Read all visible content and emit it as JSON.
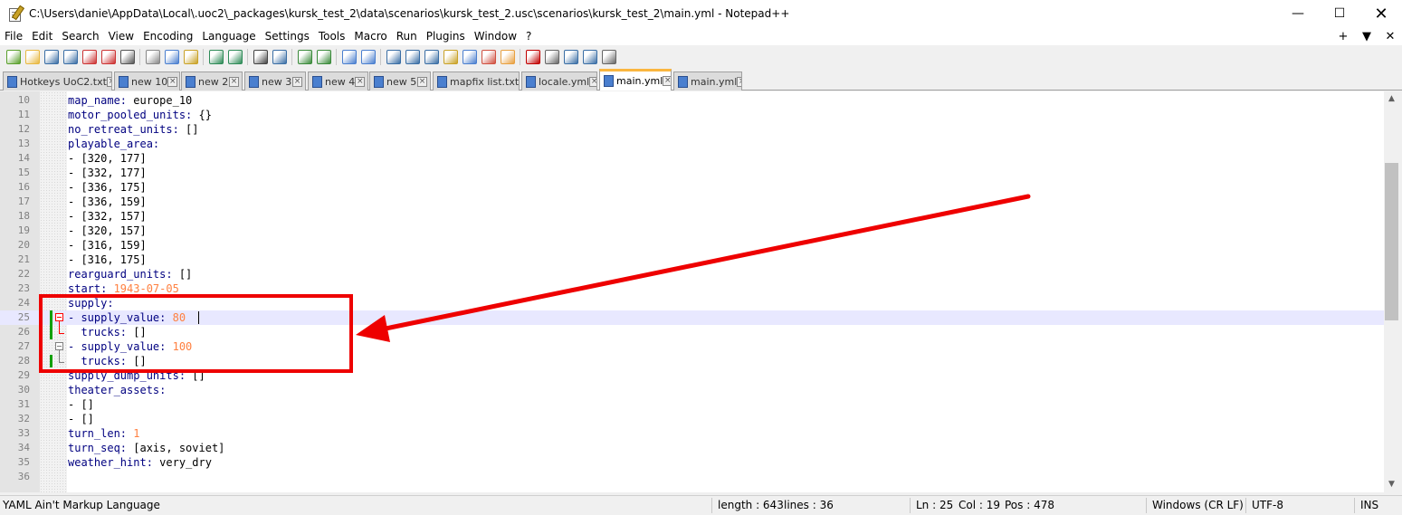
{
  "window": {
    "title": "C:\\Users\\danie\\AppData\\Local\\.uoc2\\_packages\\kursk_test_2\\data\\scenarios\\kursk_test_2.usc\\scenarios\\kursk_test_2\\main.yml - Notepad++",
    "minimize_glyph": "—",
    "maximize_glyph": "☐",
    "close_glyph": "✕"
  },
  "menu": {
    "items": [
      "File",
      "Edit",
      "Search",
      "View",
      "Encoding",
      "Language",
      "Settings",
      "Tools",
      "Macro",
      "Run",
      "Plugins",
      "Window",
      "?"
    ],
    "right": [
      "+",
      "▼",
      "✕"
    ]
  },
  "toolbar": {
    "icons": [
      "new-file-icon",
      "open-file-icon",
      "save-icon",
      "save-all-icon",
      "close-icon",
      "close-all-icon",
      "print-icon",
      "cut-icon",
      "copy-icon",
      "paste-icon",
      "undo-icon",
      "redo-icon",
      "find-icon",
      "replace-icon",
      "zoom-in-icon",
      "zoom-out-icon",
      "sync-vertical-icon",
      "sync-horizontal-icon",
      "word-wrap-icon",
      "show-all-chars-icon",
      "indent-guide-icon",
      "doc-map-icon",
      "function-list-icon",
      "folder-workspace-icon",
      "monitoring-icon",
      "record-macro-icon",
      "stop-macro-icon",
      "play-macro-icon",
      "run-macro-multiple-icon",
      "save-macro-icon"
    ]
  },
  "tabs": [
    {
      "label": "Hotkeys UoC2.txt",
      "active": false,
      "icon": "blue"
    },
    {
      "label": "new 10",
      "active": false,
      "icon": "blue"
    },
    {
      "label": "new 2",
      "active": false,
      "icon": "blue"
    },
    {
      "label": "new 3",
      "active": false,
      "icon": "blue"
    },
    {
      "label": "new 4",
      "active": false,
      "icon": "blue"
    },
    {
      "label": "new 5",
      "active": false,
      "icon": "blue"
    },
    {
      "label": "mapfix list.txt",
      "active": false,
      "icon": "blue"
    },
    {
      "label": "locale.yml",
      "active": false,
      "icon": "blue"
    },
    {
      "label": "main.yml",
      "active": true,
      "icon": "blue"
    },
    {
      "label": "main.yml",
      "active": false,
      "icon": "blue"
    }
  ],
  "editor": {
    "current_line": 25,
    "lines": [
      {
        "n": "10",
        "k": "map_name:",
        "v": " europe_10",
        "t": "str"
      },
      {
        "n": "11",
        "k": "motor_pooled_units:",
        "v": " {}",
        "t": "str"
      },
      {
        "n": "12",
        "k": "no_retreat_units:",
        "v": " []",
        "t": "str"
      },
      {
        "n": "13",
        "k": "playable_area:",
        "v": "",
        "t": "str"
      },
      {
        "n": "14",
        "k": "",
        "v": "- [320, 177]",
        "t": "str"
      },
      {
        "n": "15",
        "k": "",
        "v": "- [332, 177]",
        "t": "str"
      },
      {
        "n": "16",
        "k": "",
        "v": "- [336, 175]",
        "t": "str"
      },
      {
        "n": "17",
        "k": "",
        "v": "- [336, 159]",
        "t": "str"
      },
      {
        "n": "18",
        "k": "",
        "v": "- [332, 157]",
        "t": "str"
      },
      {
        "n": "19",
        "k": "",
        "v": "- [320, 157]",
        "t": "str"
      },
      {
        "n": "20",
        "k": "",
        "v": "- [316, 159]",
        "t": "str"
      },
      {
        "n": "21",
        "k": "",
        "v": "- [316, 175]",
        "t": "str"
      },
      {
        "n": "22",
        "k": "rearguard_units:",
        "v": " []",
        "t": "str"
      },
      {
        "n": "23",
        "k": "start:",
        "v": " 1943-07-05",
        "t": "num"
      },
      {
        "n": "24",
        "k": "supply:",
        "v": "",
        "t": "str"
      },
      {
        "n": "25",
        "k": "- supply_value:",
        "v": " 80",
        "t": "num"
      },
      {
        "n": "26",
        "k": "  trucks:",
        "v": " []",
        "t": "str"
      },
      {
        "n": "27",
        "k": "- supply_value:",
        "v": " 100",
        "t": "num"
      },
      {
        "n": "28",
        "k": "  trucks:",
        "v": " []",
        "t": "str"
      },
      {
        "n": "29",
        "k": "supply_dump_units:",
        "v": " []",
        "t": "str"
      },
      {
        "n": "30",
        "k": "theater_assets:",
        "v": "",
        "t": "str"
      },
      {
        "n": "31",
        "k": "",
        "v": "- []",
        "t": "str"
      },
      {
        "n": "32",
        "k": "",
        "v": "- []",
        "t": "str"
      },
      {
        "n": "33",
        "k": "turn_len:",
        "v": " 1",
        "t": "num"
      },
      {
        "n": "34",
        "k": "turn_seq:",
        "v": " [axis, soviet]",
        "t": "str"
      },
      {
        "n": "35",
        "k": "weather_hint:",
        "v": " very_dry",
        "t": "str"
      },
      {
        "n": "36",
        "k": "",
        "v": "",
        "t": "str"
      }
    ]
  },
  "scrollbar": {
    "up": "▲",
    "down": "▼"
  },
  "status": {
    "language": "YAML Ain't Markup Language",
    "length": "length : 643",
    "lines": "lines : 36",
    "ln": "Ln : 25",
    "col": "Col : 19",
    "pos": "Pos : 478",
    "eol": "Windows (CR LF)",
    "encoding": "UTF-8",
    "mode": "INS"
  },
  "colors": {
    "annotation": "#ee0000",
    "current_line": "#e8e8ff",
    "active_tab_accent": "#fab640",
    "yaml_key": "#000080",
    "yaml_number": "#ff8040",
    "change_marker": "#12a000"
  }
}
